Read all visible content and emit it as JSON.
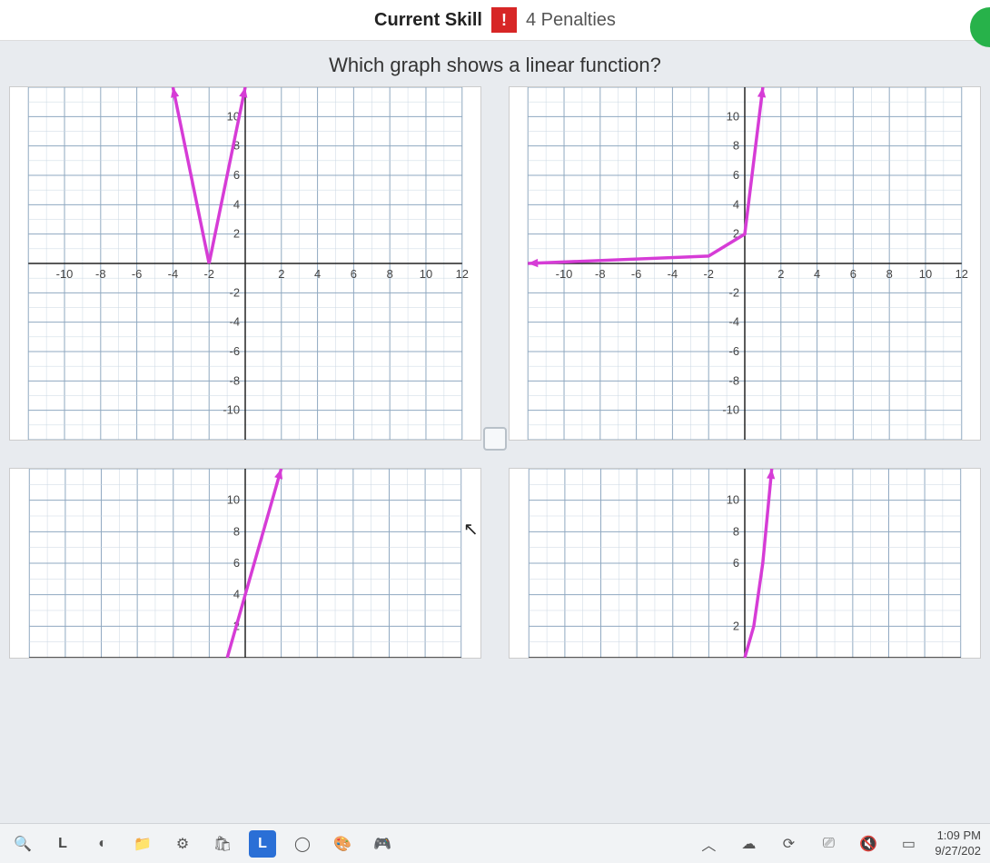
{
  "header": {
    "skill_label": "Current Skill",
    "warn_symbol": "!",
    "penalties_text": "4 Penalties"
  },
  "question": "Which graph shows a linear function?",
  "chart_data": [
    {
      "type": "line",
      "id": "graph-a",
      "description": "V-shaped absolute value graph",
      "xlim": [
        -12,
        12
      ],
      "ylim": [
        -12,
        12
      ],
      "x_ticks": [
        -10,
        -8,
        -6,
        -4,
        -2,
        2,
        4,
        6,
        8,
        10,
        12
      ],
      "y_ticks": [
        -10,
        -8,
        -6,
        -4,
        -2,
        2,
        4,
        6,
        8,
        10
      ],
      "series": [
        {
          "name": "left-ray",
          "points": [
            [
              -4,
              12
            ],
            [
              -2,
              0
            ]
          ],
          "arrow_start": true
        },
        {
          "name": "right-ray",
          "points": [
            [
              -2,
              0
            ],
            [
              0,
              12
            ]
          ],
          "arrow_end": true
        }
      ]
    },
    {
      "type": "line",
      "id": "graph-b",
      "description": "Horizontal ray then sharp vertical rise",
      "xlim": [
        -12,
        12
      ],
      "ylim": [
        -12,
        12
      ],
      "x_ticks": [
        -10,
        -8,
        -6,
        -4,
        -2,
        2,
        4,
        6,
        8,
        10,
        12
      ],
      "y_ticks": [
        -10,
        -8,
        -6,
        -4,
        -2,
        2,
        4,
        6,
        8,
        10
      ],
      "series": [
        {
          "name": "curve",
          "points": [
            [
              -12,
              0
            ],
            [
              -2,
              0.5
            ],
            [
              0,
              2
            ],
            [
              1,
              12
            ]
          ],
          "arrow_start": true,
          "arrow_end": true
        }
      ]
    },
    {
      "type": "line",
      "id": "graph-c",
      "description": "Straight line (linear) — partial view",
      "xlim": [
        -12,
        12
      ],
      "ylim": [
        0,
        12
      ],
      "x_ticks": [],
      "y_ticks": [
        2,
        4,
        6,
        8,
        10
      ],
      "series": [
        {
          "name": "line",
          "points": [
            [
              -1,
              0
            ],
            [
              2,
              12
            ]
          ],
          "arrow_end": true
        }
      ]
    },
    {
      "type": "line",
      "id": "graph-d",
      "description": "Steep curved branch — partial view",
      "xlim": [
        -12,
        12
      ],
      "ylim": [
        0,
        12
      ],
      "x_ticks": [],
      "y_ticks": [
        2,
        6,
        8,
        10
      ],
      "series": [
        {
          "name": "curve",
          "points": [
            [
              0,
              0
            ],
            [
              0.5,
              2
            ],
            [
              1,
              6
            ],
            [
              1.5,
              12
            ]
          ],
          "arrow_end": true
        }
      ]
    }
  ],
  "taskbar": {
    "icons": [
      "search",
      "L",
      "edge",
      "files",
      "settings",
      "store",
      "L-app",
      "circle",
      "color",
      "game"
    ],
    "sys": [
      "chevron-up",
      "cloud",
      "sync",
      "cast",
      "volume",
      "battery"
    ],
    "time": "1:09 PM",
    "date": "9/27/202"
  }
}
